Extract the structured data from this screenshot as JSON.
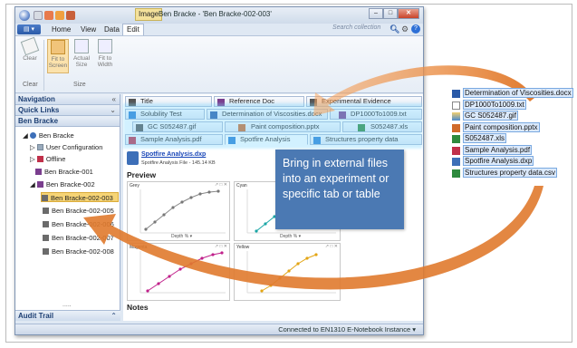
{
  "window": {
    "image_tag": "Image",
    "title": "Ben Bracke - 'Ben Bracke-002-003'",
    "buttons": [
      "–",
      "□",
      "✕"
    ]
  },
  "menu": {
    "file": "▤ ▾",
    "items": [
      "Home",
      "View",
      "Data"
    ],
    "edit": "Edit",
    "search_placeholder": "Search collection"
  },
  "ribbon": {
    "buttons": [
      "Clear",
      "Fit to Screen",
      "Actual Size",
      "Fit to Width"
    ],
    "groups": [
      "Clear",
      "Size"
    ]
  },
  "navigation": {
    "header": "Navigation",
    "quick_links": "Quick Links",
    "section": "Ben Bracke",
    "tree": [
      "Ben Bracke",
      "User Configuration",
      "Offline",
      "Ben Bracke-001",
      "Ben Bracke-002",
      "Ben Bracke-002-003",
      "Ben Bracke-002-005",
      "Ben Bracke-002-006",
      "Ben Bracke-002-007",
      "Ben Bracke-002-008"
    ],
    "more": ".....",
    "audit_trail": "Audit Trail"
  },
  "tabs": {
    "row1": [
      "Title",
      "Reference Doc",
      "Experimental Evidence"
    ],
    "row2": [
      "Solubility Test",
      "Determination of Viscosities.docx",
      "DP1000To1009.txt"
    ],
    "row3": [
      "GC S052487.gif",
      "Paint composition.pptx",
      "S052487.xls"
    ],
    "row4": [
      "Sample Analysis.pdf",
      "Spotfire Analysis",
      "Structures property data"
    ]
  },
  "content": {
    "file_name": "Spotfire Analysis.dxp",
    "file_sub": "Spotfire Analysis File - 145.14 KB",
    "preview": "Preview",
    "plots": [
      "Grey",
      "Cyan",
      "Magenta",
      "Yellow"
    ],
    "plot_xlabel": "Depth % ▾",
    "notes": "Notes"
  },
  "status": {
    "connection": "Connected to EN1310 E-Notebook Instance ▾"
  },
  "callout": {
    "text": "Bring in external files into an experiment or specific tab or table"
  },
  "external_files": [
    "Determination of Viscosities.docx",
    "DP1000To1009.txt",
    "GC S052487.gif",
    "Paint composition.pptx",
    "S052487.xls",
    "Sample Analysis.pdf",
    "Spotfire Analysis.dxp",
    "Structures property data.csv"
  ],
  "colors": {
    "arrow": "#e07a2e",
    "callout": "#4b79b3",
    "highlight": "#f6d475",
    "plot_grey": "#888888",
    "plot_cyan": "#1aa6a6",
    "plot_magenta": "#c0208a",
    "plot_yellow": "#e3a514"
  }
}
